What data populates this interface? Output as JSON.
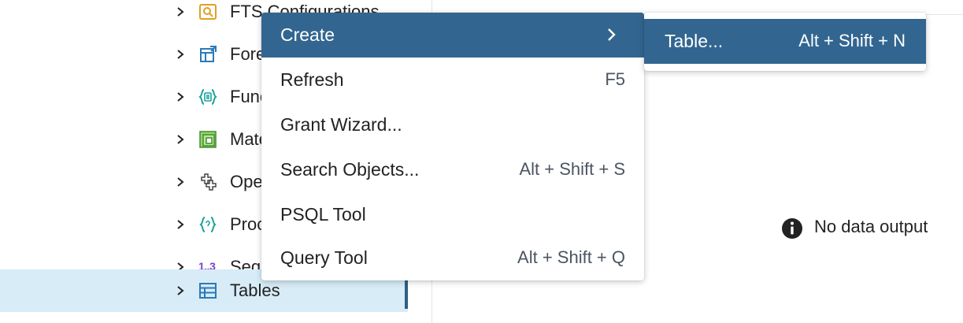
{
  "tree": {
    "items": [
      {
        "label": "FTS Configurations",
        "icon": "fts-icon",
        "selected": false
      },
      {
        "label": "Foreign Tables",
        "icon": "foreign-table-icon",
        "selected": false
      },
      {
        "label": "Functions",
        "icon": "function-icon",
        "selected": false
      },
      {
        "label": "Materialized Views",
        "icon": "materialized-view-icon",
        "selected": false
      },
      {
        "label": "Operators",
        "icon": "operator-icon",
        "selected": false
      },
      {
        "label": "Procedures",
        "icon": "procedure-icon",
        "selected": false
      },
      {
        "label": "Sequences",
        "icon": "sequence-icon",
        "icon_text": "1..3",
        "selected": false
      },
      {
        "label": "Tables",
        "icon": "table-icon",
        "selected": true
      }
    ]
  },
  "context_menu": {
    "items": [
      {
        "label": "Create",
        "shortcut": "",
        "has_submenu": true,
        "active": true
      },
      {
        "label": "Refresh",
        "shortcut": "F5"
      },
      {
        "label": "Grant Wizard...",
        "shortcut": ""
      },
      {
        "label": "Search Objects...",
        "shortcut": "Alt + Shift + S"
      },
      {
        "label": "PSQL Tool",
        "shortcut": ""
      },
      {
        "label": "Query Tool",
        "shortcut": "Alt + Shift + Q"
      }
    ]
  },
  "submenu": {
    "items": [
      {
        "label": "Table...",
        "shortcut": "Alt + Shift + N",
        "active": true
      }
    ]
  },
  "output": {
    "message": "No data output",
    "icon": "info-icon"
  },
  "colors": {
    "menu_active_bg": "#326690",
    "selected_row_bg": "#d7ecf7",
    "selected_row_bar": "#2d5f86"
  }
}
